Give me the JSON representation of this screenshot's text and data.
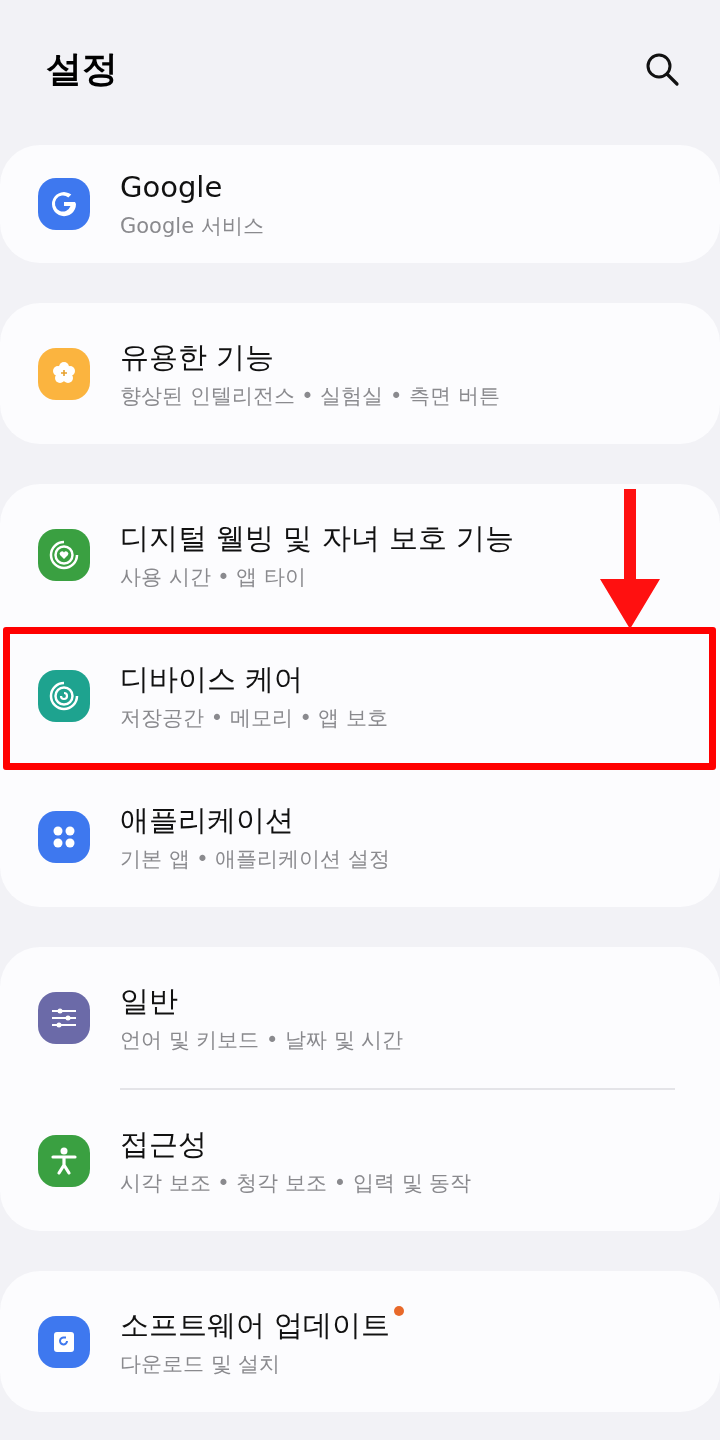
{
  "header": {
    "title": "설정"
  },
  "groups": [
    {
      "items": [
        {
          "kind": "google",
          "color": "#3e78ef",
          "title": "Google",
          "subtitle": "Google 서비스",
          "highlighted": false,
          "badge": false
        }
      ]
    },
    {
      "items": [
        {
          "kind": "flower",
          "color": "#fbb43f",
          "title": "유용한 기능",
          "subtitle": "향상된 인텔리전스 • 실험실 • 측면 버튼",
          "highlighted": false,
          "badge": false
        }
      ]
    },
    {
      "items": [
        {
          "kind": "heart-ring",
          "color": "#3aa041",
          "title": "디지털 웰빙 및 자녀 보호 기능",
          "subtitle": "사용 시간 • 앱 타이",
          "highlighted": false,
          "badge": false
        },
        {
          "kind": "care-ring",
          "color": "#1ea38f",
          "title": "디바이스 케어",
          "subtitle": "저장공간 • 메모리 • 앱 보호",
          "highlighted": true,
          "badge": false
        },
        {
          "kind": "grid",
          "color": "#3e78ef",
          "title": "애플리케이션",
          "subtitle": "기본 앱 • 애플리케이션 설정",
          "highlighted": false,
          "badge": false
        }
      ]
    },
    {
      "items": [
        {
          "kind": "sliders",
          "color": "#6b6aa8",
          "title": "일반",
          "subtitle": "언어 및 키보드 • 날짜 및 시간",
          "highlighted": false,
          "badge": false
        },
        {
          "kind": "person",
          "color": "#3aa041",
          "title": "접근성",
          "subtitle": "시각 보조 • 청각 보조 • 입력 및 동작",
          "highlighted": false,
          "badge": false
        }
      ]
    },
    {
      "items": [
        {
          "kind": "update",
          "color": "#3e78ef",
          "title": "소프트웨어 업데이트",
          "subtitle": "다운로드 및 설치",
          "highlighted": false,
          "badge": true
        }
      ]
    }
  ]
}
